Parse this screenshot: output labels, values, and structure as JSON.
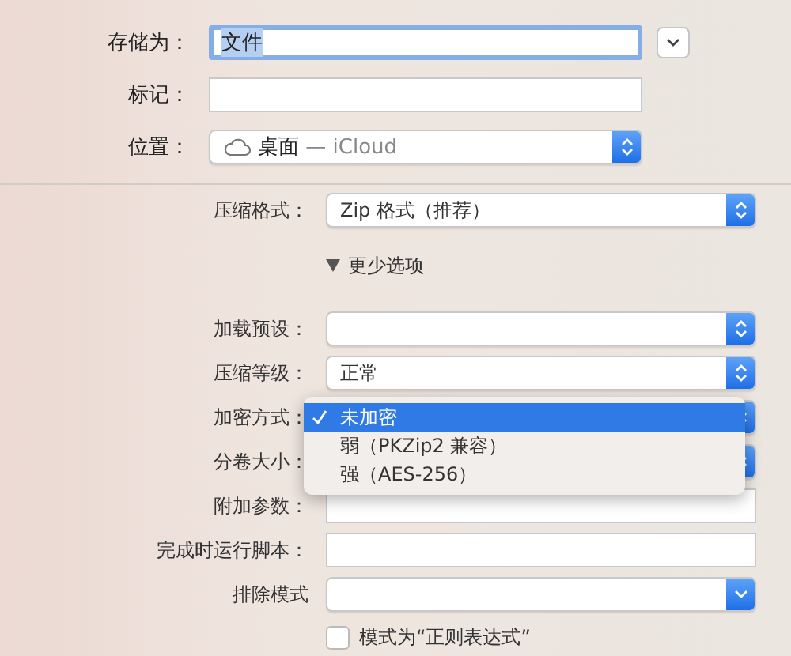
{
  "top_rows": [
    {
      "kind": "name",
      "label": "存储为：",
      "value": "文件",
      "value_selected": true
    },
    {
      "kind": "tags",
      "label": "标记："
    },
    {
      "kind": "location",
      "label": "位置：",
      "value": "桌面",
      "suffix": "— iCloud"
    }
  ],
  "format": {
    "label": "压缩格式：",
    "value": "Zip 格式（推荐）"
  },
  "disclosure": {
    "label": "更少选项",
    "expanded": true
  },
  "options": [
    {
      "kind": "popup",
      "label": "加载预设："
    },
    {
      "kind": "popup",
      "label": "压缩等级：",
      "value": "正常"
    },
    {
      "kind": "popup",
      "label": "加密方式："
    },
    {
      "kind": "popup",
      "label": "分卷大小："
    },
    {
      "kind": "field",
      "label": "附加参数："
    },
    {
      "kind": "field",
      "label": "完成时运行脚本："
    },
    {
      "kind": "combo",
      "label": "排除模式"
    }
  ],
  "menu": [
    {
      "label": "未加密",
      "selected": true
    },
    {
      "label": "弱（PKZip2 兼容）",
      "selected": false
    },
    {
      "label": "强（AES-256）",
      "selected": false
    }
  ],
  "checkbox": {
    "label": "模式为“正则表达式”",
    "checked": false
  }
}
